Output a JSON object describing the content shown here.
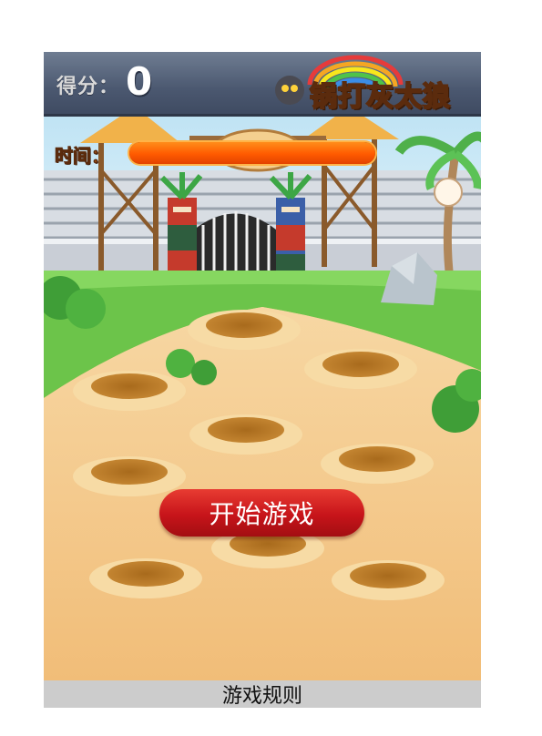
{
  "hud": {
    "score_label": "得分：",
    "score_value": "0",
    "time_label": "时间：",
    "time_remaining_fraction": 1.0,
    "logo_text": "锅打灰太狼"
  },
  "start_button": {
    "label": "开始游戏"
  },
  "rules_bar": {
    "label": "游戏规则"
  },
  "holes": [
    {
      "id": 1
    },
    {
      "id": 2
    },
    {
      "id": 3
    },
    {
      "id": 4
    },
    {
      "id": 5
    },
    {
      "id": 6
    },
    {
      "id": 7
    },
    {
      "id": 8
    },
    {
      "id": 9
    }
  ],
  "colors": {
    "time_fill": "#ff5a00",
    "start_button": "#c7141a",
    "rules_bar_bg": "#cccccc",
    "ground": "#f3c586"
  }
}
